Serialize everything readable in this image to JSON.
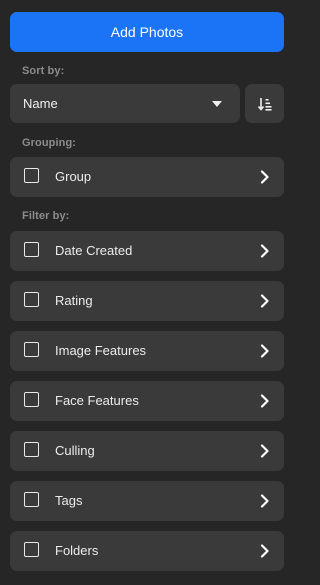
{
  "add_photos": {
    "label": "Add Photos"
  },
  "sort": {
    "label": "Sort by:",
    "selected": "Name",
    "direction_icon": "sort-ascending-icon"
  },
  "grouping": {
    "label": "Grouping:",
    "items": [
      {
        "label": "Group",
        "checked": false
      }
    ]
  },
  "filter": {
    "label": "Filter by:",
    "items": [
      {
        "label": "Date Created",
        "checked": false
      },
      {
        "label": "Rating",
        "checked": false
      },
      {
        "label": "Image Features",
        "checked": false
      },
      {
        "label": "Face Features",
        "checked": false
      },
      {
        "label": "Culling",
        "checked": false
      },
      {
        "label": "Tags",
        "checked": false
      },
      {
        "label": "Folders",
        "checked": false
      }
    ]
  },
  "colors": {
    "background": "#262626",
    "row": "#3a3a3a",
    "accent": "#1a74f5",
    "section_label": "#8c8c8c"
  }
}
